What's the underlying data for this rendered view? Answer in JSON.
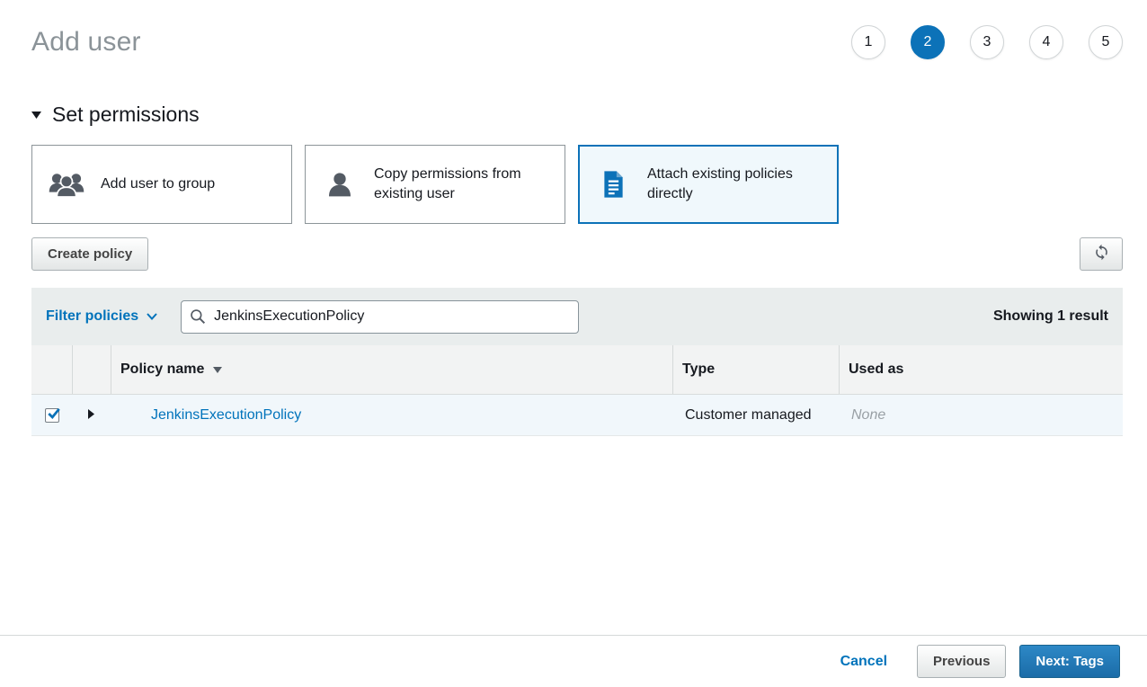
{
  "page": {
    "title": "Add user"
  },
  "steps": {
    "labels": [
      "1",
      "2",
      "3",
      "4",
      "5"
    ],
    "active_index": 1
  },
  "permissions_section": {
    "title": "Set permissions",
    "options": [
      {
        "label": "Add user to group",
        "icon": "user-group-icon",
        "selected": false
      },
      {
        "label": "Copy permissions from existing user",
        "icon": "user-icon",
        "selected": false
      },
      {
        "label": "Attach existing policies directly",
        "icon": "policy-document-icon",
        "selected": true
      }
    ]
  },
  "toolbar": {
    "create_policy_label": "Create policy",
    "refresh_icon": "refresh-icon"
  },
  "filter_bar": {
    "dropdown_label": "Filter policies",
    "search_value": "JenkinsExecutionPolicy",
    "search_icon": "search-icon",
    "results_text": "Showing 1 result"
  },
  "policies_table": {
    "columns": {
      "policy_name": "Policy name",
      "type": "Type",
      "used_as": "Used as"
    },
    "sorted_column": "policy_name",
    "sort_direction": "descending",
    "rows": [
      {
        "checked": true,
        "policy_name": "JenkinsExecutionPolicy",
        "type": "Customer managed",
        "used_as": "None"
      }
    ]
  },
  "footer": {
    "cancel_label": "Cancel",
    "previous_label": "Previous",
    "next_label": "Next: Tags"
  },
  "colors": {
    "accent_blue": "#0073bb",
    "active_step_blue": "#0c72b8",
    "selected_card_bg": "#f0f8fc",
    "selected_row_bg": "#f1f7fb",
    "filter_bar_bg": "#e9eded",
    "table_header_bg": "#f2f3f3",
    "title_gray": "#8b9398"
  }
}
